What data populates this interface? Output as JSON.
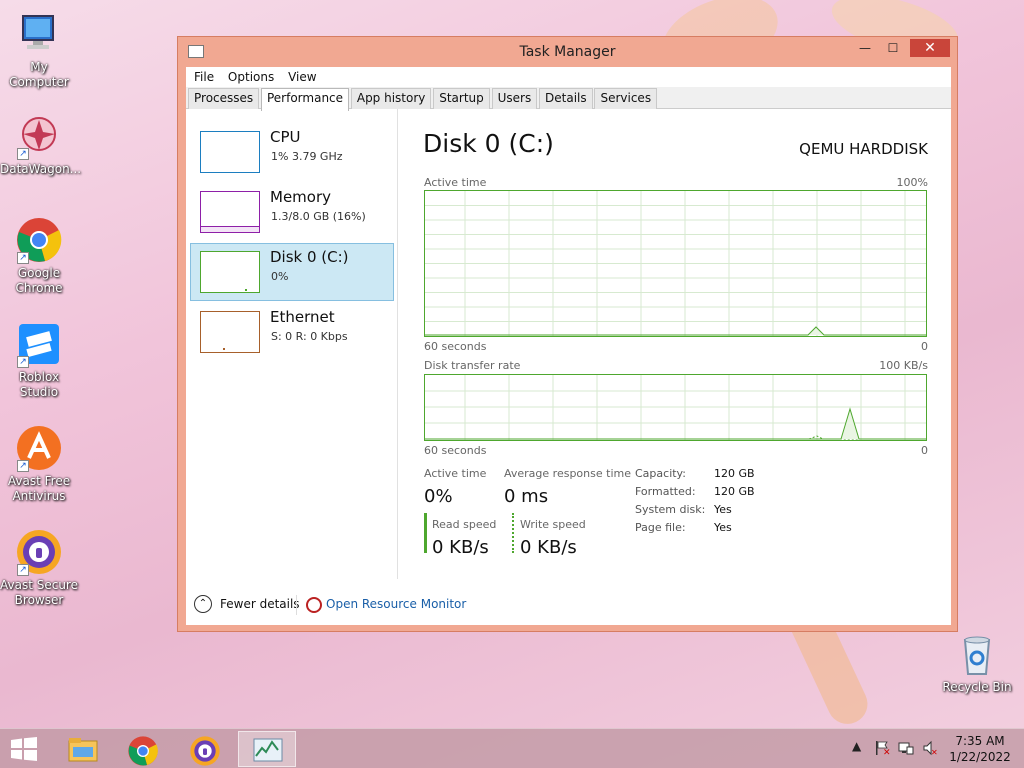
{
  "desktop": {
    "icons": [
      {
        "label": "My Computer",
        "icon": "computer-icon"
      },
      {
        "label": "DataWagon...",
        "icon": "datawagon-icon"
      },
      {
        "label": "Google Chrome",
        "icon": "chrome-icon"
      },
      {
        "label": "Roblox Studio",
        "icon": "roblox-studio-icon"
      },
      {
        "label": "Avast Free Antivirus",
        "icon": "avast-icon"
      },
      {
        "label": "Avast Secure Browser",
        "icon": "avast-browser-icon"
      },
      {
        "label": "Recycle Bin",
        "icon": "recycle-bin-icon"
      }
    ]
  },
  "window": {
    "title": "Task Manager",
    "controls": {
      "minimize": "—",
      "maximize": "☐",
      "close": "✕"
    }
  },
  "menu": [
    "File",
    "Options",
    "View"
  ],
  "tabs": [
    "Processes",
    "Performance",
    "App history",
    "Startup",
    "Users",
    "Details",
    "Services"
  ],
  "active_tab": "Performance",
  "resources": [
    {
      "name": "CPU",
      "value": "1%  3.79 GHz",
      "color": "#1c7ec0",
      "selected": false
    },
    {
      "name": "Memory",
      "value": "1.3/8.0 GB (16%)",
      "color": "#8e1fa8",
      "selected": false
    },
    {
      "name": "Disk 0 (C:)",
      "value": "0%",
      "color": "#4ea72e",
      "selected": true
    },
    {
      "name": "Ethernet",
      "value": "S: 0  R: 0 Kbps",
      "color": "#a7602b",
      "selected": false
    }
  ],
  "detail": {
    "title": "Disk 0 (C:)",
    "model": "QEMU HARDDISK",
    "graph1": {
      "label": "Active time",
      "max": "100%",
      "time": "60 seconds",
      "min": "0"
    },
    "graph2": {
      "label": "Disk transfer rate",
      "max": "100 KB/s",
      "time": "60 seconds",
      "min": "0"
    },
    "stats": {
      "active_time_label": "Active time",
      "active_time_value": "0%",
      "avg_response_label": "Average response time",
      "avg_response_value": "0 ms",
      "read_label": "Read speed",
      "read_value": "0 KB/s",
      "write_label": "Write speed",
      "write_value": "0 KB/s"
    },
    "properties": [
      {
        "key": "Capacity:",
        "value": "120 GB"
      },
      {
        "key": "Formatted:",
        "value": "120 GB"
      },
      {
        "key": "System disk:",
        "value": "Yes"
      },
      {
        "key": "Page file:",
        "value": "Yes"
      }
    ]
  },
  "footer": {
    "fewer_details": "Fewer details",
    "open_resource_monitor": "Open Resource Monitor"
  },
  "taskbar": {
    "apps": [
      "file-explorer-icon",
      "chrome-icon",
      "avast-browser-icon",
      "task-manager-icon"
    ],
    "time": "7:35 AM",
    "date": "1/22/2022"
  },
  "colors": {
    "disk_green": "#4ea72e",
    "grid": "#d7ead0",
    "selected_bg": "#cce8f4",
    "window_frame": "#f1a892"
  }
}
